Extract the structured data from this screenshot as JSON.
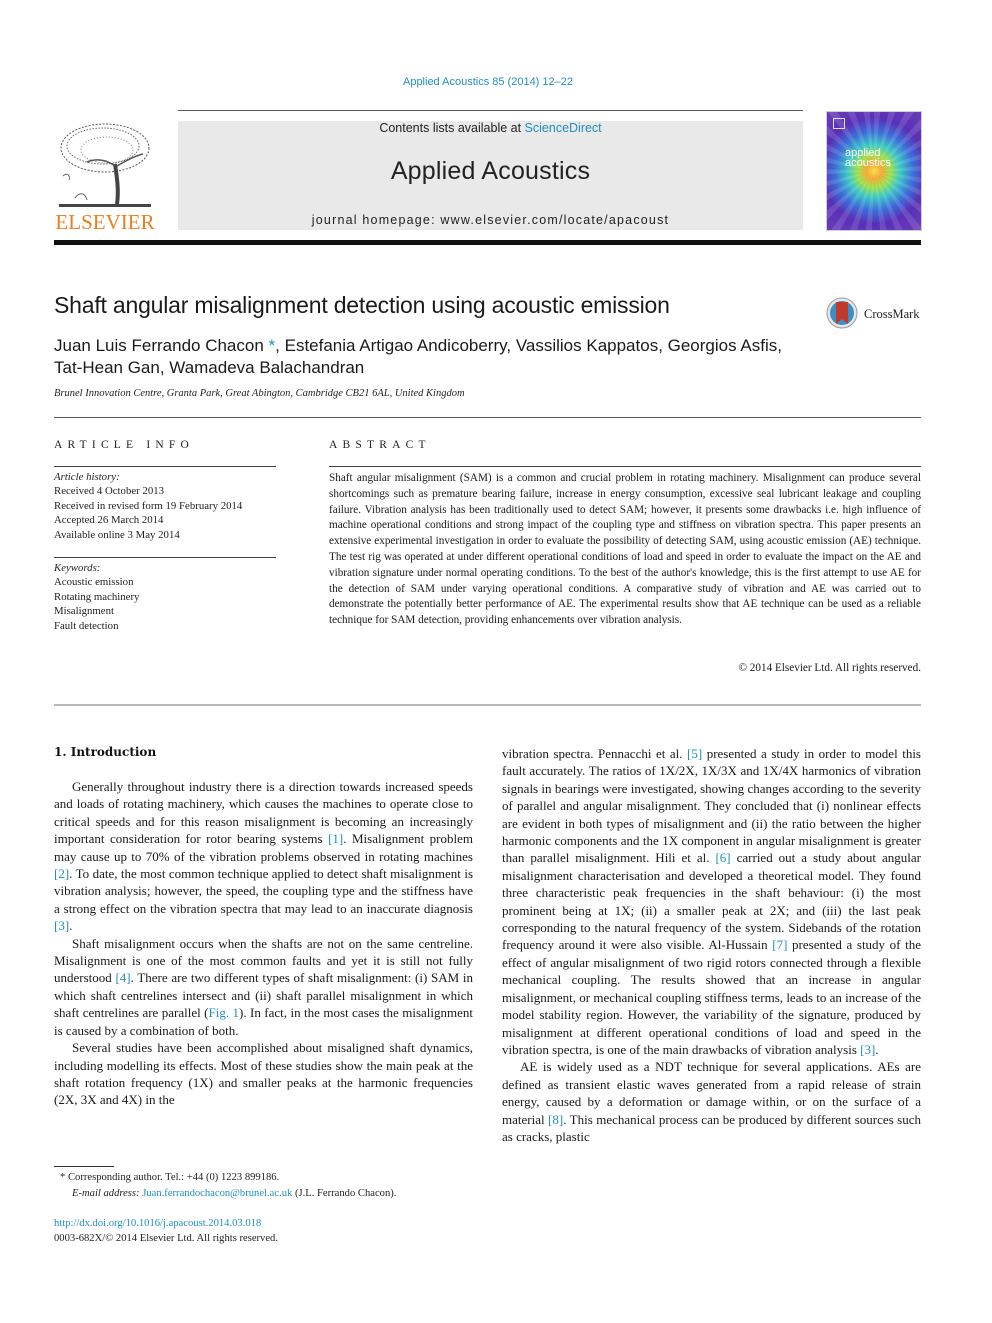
{
  "header": {
    "journal_ref": "Applied Acoustics 85 (2014) 12–22",
    "contents_prefix": "Contents lists available at ",
    "contents_link": "ScienceDirect",
    "journal_title": "Applied Acoustics",
    "homepage_prefix": "journal homepage: ",
    "homepage_url": "www.elsevier.com/locate/apacoust",
    "publisher_logo": "ELSEVIER",
    "cover_title_line1": "applied",
    "cover_title_line2": "acoustics",
    "accent_color": "#1f8fbf",
    "publisher_color": "#ee7d1f"
  },
  "article": {
    "title": "Shaft angular misalignment detection using acoustic emission",
    "crossmark_label": "CrossMark",
    "authors": {
      "first": "Juan Luis Ferrando Chacon",
      "star": "*",
      "rest_line1": ", Estefania Artigao Andicoberry, Vassilios Kappatos, Georgios Asfis,",
      "line2": "Tat-Hean Gan, Wamadeva Balachandran"
    },
    "affiliation": "Brunel Innovation Centre, Granta Park, Great Abington, Cambridge CB21 6AL, United Kingdom"
  },
  "article_info": {
    "heading": "ARTICLE INFO",
    "history_label": "Article history:",
    "history": [
      "Received 4 October 2013",
      "Received in revised form 19 February 2014",
      "Accepted 26 March 2014",
      "Available online 3 May 2014"
    ],
    "keywords_label": "Keywords:",
    "keywords": [
      "Acoustic emission",
      "Rotating machinery",
      "Misalignment",
      "Fault detection"
    ]
  },
  "abstract": {
    "heading": "ABSTRACT",
    "text": "Shaft angular misalignment (SAM) is a common and crucial problem in rotating machinery. Misalignment can produce several shortcomings such as premature bearing failure, increase in energy consumption, excessive seal lubricant leakage and coupling failure. Vibration analysis has been traditionally used to detect SAM; however, it presents some drawbacks i.e. high influence of machine operational conditions and strong impact of the coupling type and stiffness on vibration spectra. This paper presents an extensive experimental investigation in order to evaluate the possibility of detecting SAM, using acoustic emission (AE) technique. The test rig was operated at under different operational conditions of load and speed in order to evaluate the impact on the AE and vibration signature under normal operating conditions. To the best of the author's knowledge, this is the first attempt to use AE for the detection of SAM under varying operational conditions. A comparative study of vibration and AE was carried out to demonstrate the potentially better performance of AE. The experimental results show that AE technique can be used as a reliable technique for SAM detection, providing enhancements over vibration analysis.",
    "copyright": "© 2014 Elsevier Ltd. All rights reserved."
  },
  "body": {
    "section_heading": "1. Introduction",
    "p1": {
      "a": "Generally throughout industry there is a direction towards increased speeds and loads of rotating machinery, which causes the machines to operate close to critical speeds and for this reason misalignment is becoming an increasingly important consideration for rotor bearing systems ",
      "ref1": "[1]",
      "b": ". Misalignment problem may cause up to 70% of the vibration problems observed in rotating machines ",
      "ref2": "[2]",
      "c": ". To date, the most common technique applied to detect shaft misalignment is vibration analysis; however, the speed, the coupling type and the stiffness have a strong effect on the vibration spectra that may lead to an inaccurate diagnosis ",
      "ref3": "[3]",
      "d": "."
    },
    "p2": {
      "a": "Shaft misalignment occurs when the shafts are not on the same centreline. Misalignment is one of the most common faults and yet it is still not fully understood ",
      "ref4": "[4]",
      "b": ". There are two different types of shaft misalignment: (i) SAM in which shaft centrelines intersect and (ii) shaft parallel misalignment in which shaft centrelines are parallel (",
      "fig": "Fig. 1",
      "c": "). In fact, in the most cases the misalignment is caused by a combination of both."
    },
    "p3": {
      "a": "Several studies have been accomplished about misaligned shaft dynamics, including modelling its effects. Most of these studies show the main peak at the shaft rotation frequency (1X) and smaller peaks at the harmonic frequencies (2X, 3X and 4X) in the vibration spectra. Pennacchi et al. ",
      "ref5": "[5]",
      "b": " presented a study in order to model this fault accurately. The ratios of 1X/2X, 1X/3X and 1X/4X harmonics of vibration signals in bearings were investigated, showing changes according to the severity of parallel and angular misalignment. They concluded that (i) nonlinear effects are evident in both types of misalignment and (ii) the ratio between the higher harmonic components and the 1X component in angular misalignment is greater than parallel misalignment. Hili et al. ",
      "ref6": "[6]",
      "c": " carried out a study about angular misalignment characterisation and developed a theoretical model. They found three characteristic peak frequencies in the shaft behaviour: (i) the most prominent being at 1X; (ii) a smaller peak at 2X; and (iii) the last peak corresponding to the natural frequency of the system. Sidebands of the rotation frequency around it were also visible. Al-Hussain ",
      "ref7": "[7]",
      "d": " presented a study of the effect of angular misalignment of two rigid rotors connected through a flexible mechanical coupling. The results showed that an increase in angular misalignment, or mechanical coupling stiffness terms, leads to an increase of the model stability region. However, the variability of the signature, produced by misalignment at different operational conditions of load and speed in the vibration spectra, is one of the main drawbacks of vibration analysis ",
      "ref3": "[3]",
      "e": "."
    },
    "p4": {
      "a": "AE is widely used as a NDT technique for several applications. AEs are defined as transient elastic waves generated from a rapid release of strain energy, caused by a deformation or damage within, or on the surface of a material ",
      "ref8": "[8]",
      "b": ". This mechanical process can be produced by different sources such as cracks, plastic"
    }
  },
  "footnotes": {
    "star": "*",
    "corresponding": "Corresponding author. Tel.: +44 (0) 1223 899186.",
    "email_label": "E-mail address: ",
    "email": "Juan.ferrandochacon@brunel.ac.uk",
    "email_suffix": " (J.L. Ferrando Chacon).",
    "doi": "http://dx.doi.org/10.1016/j.apacoust.2014.03.018",
    "issn_copyright": "0003-682X/© 2014 Elsevier Ltd. All rights reserved."
  }
}
